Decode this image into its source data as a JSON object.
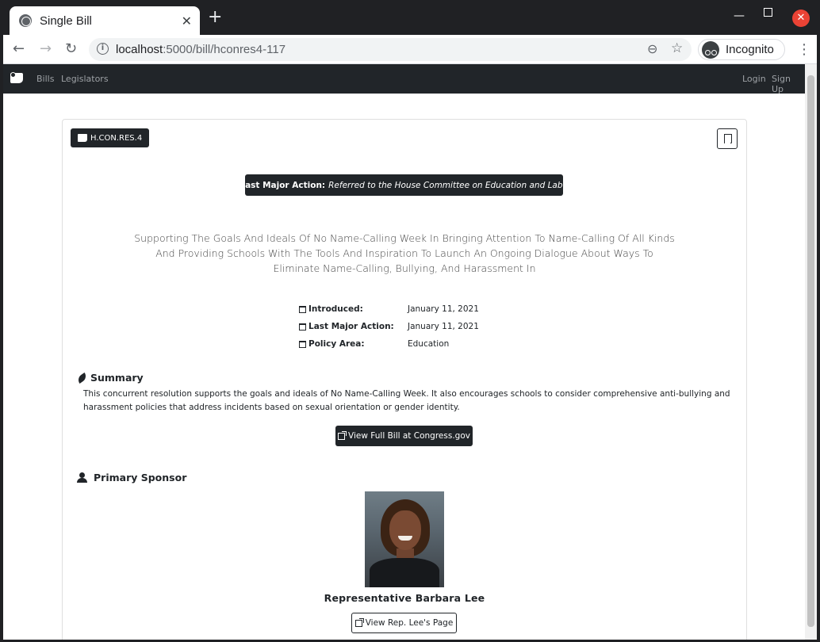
{
  "browser": {
    "tab_title": "Single Bill",
    "new_tab": "+",
    "url_host": "localhost",
    "url_path": ":5000/bill/hconres4-117",
    "incognito_label": "Incognito"
  },
  "navbar": {
    "links": [
      "Bills",
      "Legislators"
    ],
    "login": "Login",
    "signup": "Sign Up"
  },
  "bill": {
    "badge": "H.CON.RES.4",
    "last_action_label": "Last Major Action:",
    "last_action_text": "Referred to the House Committee on Education and Labor.",
    "title": "Supporting The Goals And Ideals Of No Name-Calling Week In Bringing Attention To Name-Calling Of All Kinds And Providing Schools With The Tools And Inspiration To Launch An Ongoing Dialogue About Ways To Eliminate Name-Calling, Bullying, And Harassment In",
    "meta": [
      {
        "label": "Introduced:",
        "value": "January 11, 2021"
      },
      {
        "label": "Last Major Action:",
        "value": "January 11, 2021"
      },
      {
        "label": "Policy Area:",
        "value": "Education"
      }
    ],
    "summary_heading": "Summary",
    "summary": "This concurrent resolution supports the goals and ideals of No Name-Calling Week. It also encourages schools to consider comprehensive anti-bullying and harassment policies that address incidents based on sexual orientation or gender identity.",
    "full_bill_button": "View Full Bill at Congress.gov",
    "sponsor_heading": "Primary Sponsor",
    "sponsor_name": "Representative Barbara Lee",
    "sponsor_button": "View Rep. Lee's Page"
  }
}
